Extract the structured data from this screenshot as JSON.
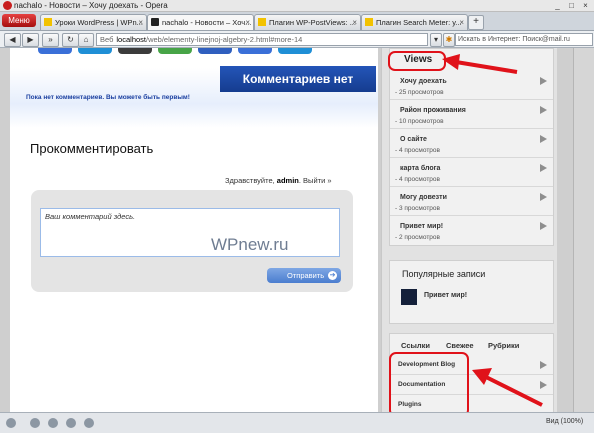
{
  "window": {
    "title": "nachalo - Новости – Хочу доехать - Opera"
  },
  "tabs_bar": {
    "menu_label": "Меню",
    "tabs": [
      {
        "label": "Уроки WordPress | WPn..."
      },
      {
        "label": "nachalo - Новости – Хоч..."
      },
      {
        "label": "Плагин WP-PostViews: ..."
      },
      {
        "label": "Плагин Search Meter: у..."
      }
    ],
    "new_tab": "+"
  },
  "address_bar": {
    "scheme_label": "Веб",
    "url_host": "localhost",
    "url_path": "/web/elementy-linejnoj-algebry-2.html#more-14",
    "search_placeholder": "Искать в Интернет: Поиск@mail.ru"
  },
  "content": {
    "no_comments_header": "Комментариев нет",
    "no_comments_text": "Пока нет комментариев. Вы можете быть первым!",
    "comment_title": "Прокомментировать",
    "greeting_prefix": "Здравствуйте, ",
    "greeting_user": "admin",
    "greeting_logout": ". Выйти »",
    "comment_placeholder": "Ваш комментарий здесь.",
    "submit_label": "Отправить",
    "watermark": "WPnew.ru",
    "share_colors": [
      "#3a6fd8",
      "#1f8fd6",
      "#3b3b3b",
      "#47a447",
      "#2f5fbf"
    ]
  },
  "sidebar": {
    "views": {
      "title": "Views",
      "items": [
        {
          "title": "Хочу доехать",
          "count": "- 25 просмотров"
        },
        {
          "title": "Район проживания",
          "count": "- 10 просмотров"
        },
        {
          "title": "О сайте",
          "count": "- 4 просмотров"
        },
        {
          "title": "карта блога",
          "count": "- 4 просмотров"
        },
        {
          "title": "Могу довезти",
          "count": "- 3 просмотров"
        },
        {
          "title": "Привет мир!",
          "count": "- 2 просмотров"
        }
      ]
    },
    "popular": {
      "title": "Популярные записи",
      "item": "Привет мир!"
    },
    "links": {
      "tabs": [
        "Ссылки",
        "Свежее",
        "Рубрики"
      ],
      "items": [
        "Development Blog",
        "Documentation",
        "Plugins"
      ]
    }
  },
  "statusbar": {
    "zoom": "Вид (100%)"
  },
  "colors": {
    "annotation": "#e0121a",
    "accent": "#1a3fa0"
  }
}
